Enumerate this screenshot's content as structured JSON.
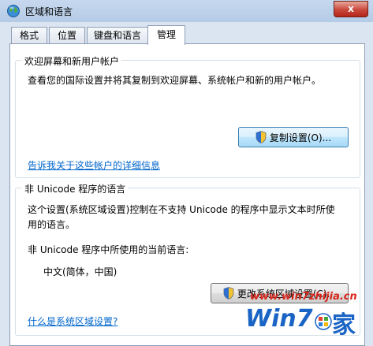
{
  "window": {
    "title": "区域和语言",
    "close_label": "x",
    "icon_name": "globe-icon"
  },
  "tabs": [
    {
      "label": "格式"
    },
    {
      "label": "位置"
    },
    {
      "label": "键盘和语言"
    },
    {
      "label": "管理"
    }
  ],
  "active_tab": "管理",
  "welcome_group": {
    "title": "欢迎屏幕和新用户帐户",
    "description": "查看您的国际设置并将其复制到欢迎屏幕、系统帐户和新的用户帐户。",
    "copy_button_label": "复制设置(O)...",
    "link_label": "告诉我关于这些帐户的详细信息"
  },
  "unicode_group": {
    "title": "非 Unicode 程序的语言",
    "description_line1": "这个设置(系统区域设置)控制在不支持 Unicode 的程序中显示文本时所使",
    "description_line2": "用的语言。",
    "current_label": "非 Unicode 程序中所使用的当前语言:",
    "current_value": "中文(简体，中国)",
    "change_button_label": "更改系统区域设置(C)...",
    "link_label": "什么是系统区域设置?"
  },
  "watermark": {
    "url": "www.win7zhijia.cn",
    "brand": "Win7",
    "suffix": "家"
  },
  "colors": {
    "link": "#0066cc",
    "close_button": "#c9483b",
    "watermark_red": "#d8261b",
    "watermark_blue": "#1a64c5"
  }
}
